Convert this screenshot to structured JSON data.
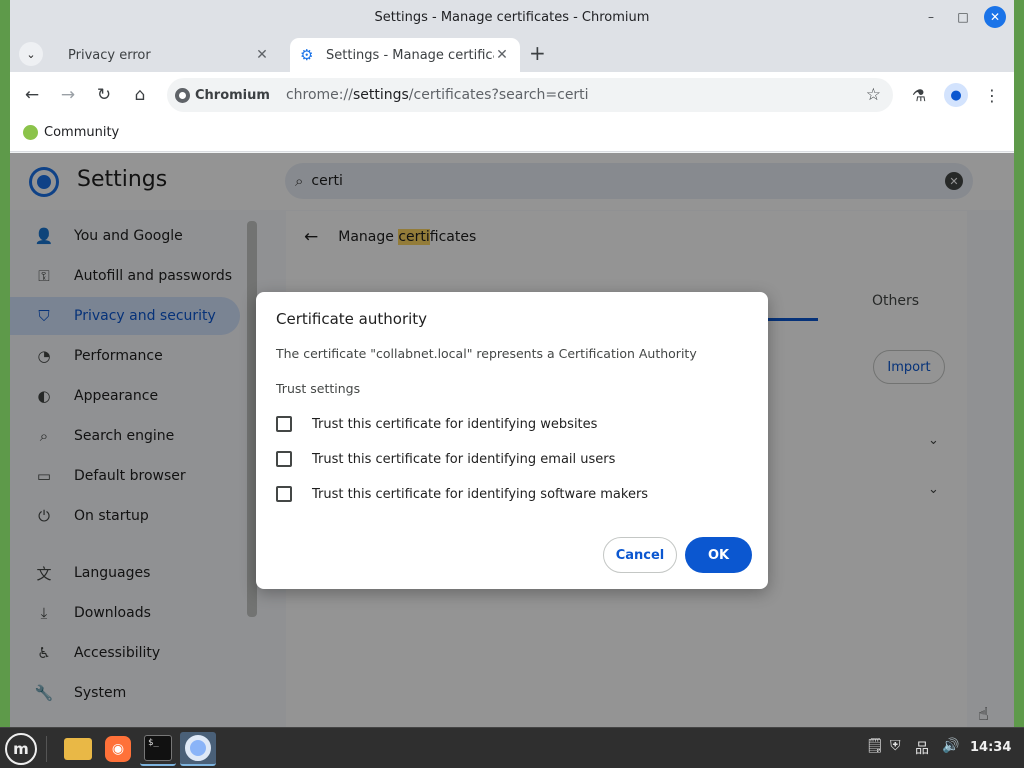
{
  "window": {
    "title": "Settings - Manage certificates - Chromium",
    "controls": {
      "minimize": "–",
      "maximize": "□",
      "close": "✕"
    }
  },
  "tabs": [
    {
      "label": "Privacy error",
      "close": "✕"
    },
    {
      "label": "Settings - Manage certificates",
      "close": "✕"
    }
  ],
  "tabstrip": {
    "down": "⌄",
    "new_tab": "+"
  },
  "toolbar": {
    "back": "←",
    "forward": "→",
    "reload": "↻",
    "home": "⌂",
    "site_chip": "Chromium",
    "url_scheme": "chrome://",
    "url_host": "settings",
    "url_path": "/certificates?search=certi",
    "bookmark_star": "☆",
    "labs": "⚗",
    "profile": "●",
    "menu": "⋮"
  },
  "bookmarks": [
    {
      "label": "Community"
    }
  ],
  "settings": {
    "title": "Settings",
    "search_value": "certi",
    "search_icon": "⌕",
    "clear": "✕"
  },
  "sidebar": {
    "items": [
      {
        "label": "You and Google",
        "icon": "person-icon",
        "glyph": "👤"
      },
      {
        "label": "Autofill and passwords",
        "icon": "key-icon",
        "glyph": "⚿"
      },
      {
        "label": "Privacy and security",
        "icon": "shield-icon",
        "glyph": "⛉"
      },
      {
        "label": "Performance",
        "icon": "speedometer-icon",
        "glyph": "◔"
      },
      {
        "label": "Appearance",
        "icon": "palette-icon",
        "glyph": "◐"
      },
      {
        "label": "Search engine",
        "icon": "search-icon",
        "glyph": "⌕"
      },
      {
        "label": "Default browser",
        "icon": "browser-icon",
        "glyph": "▭"
      },
      {
        "label": "On startup",
        "icon": "power-icon",
        "glyph": "⏻"
      },
      {
        "label": "Languages",
        "icon": "translate-icon",
        "glyph": "文"
      },
      {
        "label": "Downloads",
        "icon": "download-icon",
        "glyph": "⤓"
      },
      {
        "label": "Accessibility",
        "icon": "accessibility-icon",
        "glyph": "♿"
      },
      {
        "label": "System",
        "icon": "wrench-icon",
        "glyph": "🔧"
      }
    ]
  },
  "main": {
    "back": "←",
    "header_pre": "Manage ",
    "header_hl": "certi",
    "header_post": "ficates",
    "tab_others": "Others",
    "import_label": "Import",
    "chevron": "⌄"
  },
  "dialog": {
    "title": "Certificate authority",
    "description": "The certificate \"collabnet.local\" represents a Certification Authority",
    "trust_heading": "Trust settings",
    "options": [
      {
        "label": "Trust this certificate for identifying websites",
        "checked": false
      },
      {
        "label": "Trust this certificate for identifying email users",
        "checked": false
      },
      {
        "label": "Trust this certificate for identifying software makers",
        "checked": false
      }
    ],
    "cancel_label": "Cancel",
    "ok_label": "OK"
  },
  "taskbar": {
    "menu": "m",
    "terminal_text": "$_",
    "fox": "◉",
    "tray": {
      "notes": "🗒",
      "shield": "⛨",
      "network": "品",
      "volume": "🔊"
    },
    "clock": "14:34"
  },
  "colors": {
    "accent": "#0b57d0",
    "selected_bg": "#d3e3fd",
    "highlight": "#fdd663"
  }
}
